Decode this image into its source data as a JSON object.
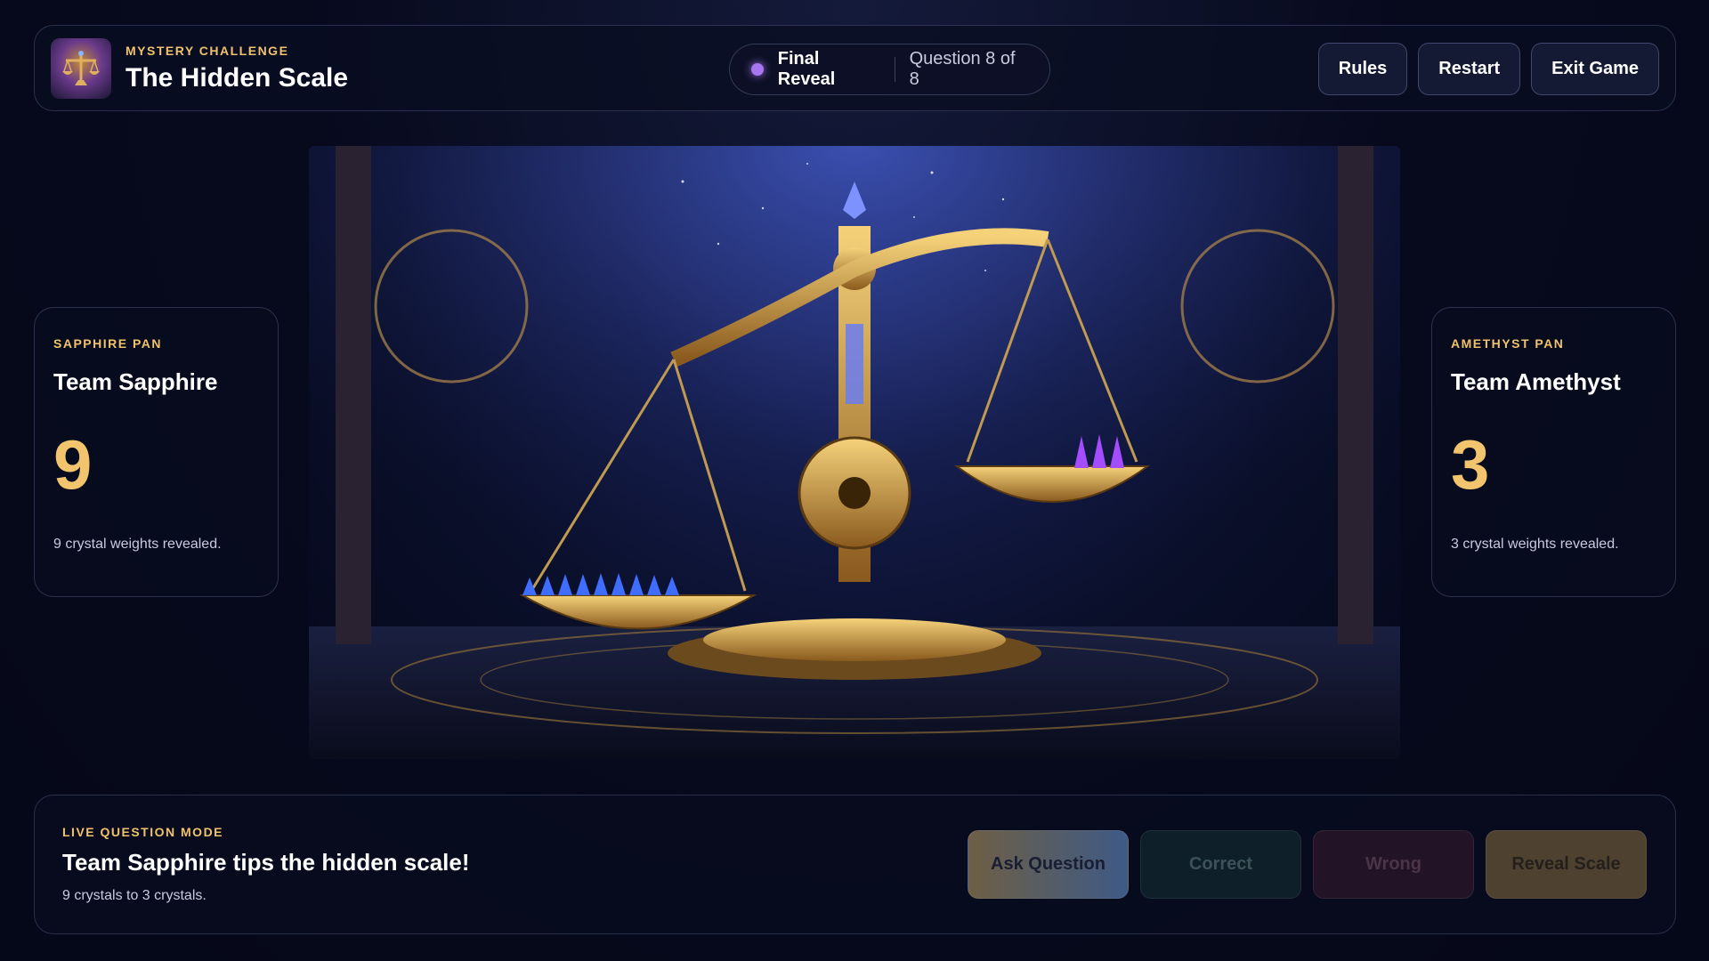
{
  "header": {
    "eyebrow": "MYSTERY CHALLENGE",
    "title": "The Hidden Scale",
    "status_phase": "Final Reveal",
    "status_question": "Question 8 of 8",
    "buttons": {
      "rules": "Rules",
      "restart": "Restart",
      "exit": "Exit Game"
    }
  },
  "teams": [
    {
      "eyebrow": "SAPPHIRE PAN",
      "name": "Team Sapphire",
      "score": "9",
      "note": "9 crystal weights revealed.",
      "color": "#4a6cff"
    },
    {
      "eyebrow": "AMETHYST PAN",
      "name": "Team Amethyst",
      "score": "3",
      "note": "3 crystal weights revealed.",
      "color": "#a44dff"
    }
  ],
  "scene": {
    "subject": "golden balance scale in observatory hall",
    "left_pan_crystals": 9,
    "right_pan_crystals": 3
  },
  "panel": {
    "eyebrow": "LIVE QUESTION MODE",
    "headline": "Team Sapphire tips the hidden scale!",
    "subline": "9 crystals to 3 crystals.",
    "buttons": {
      "ask": "Ask Question",
      "correct": "Correct",
      "wrong": "Wrong",
      "reveal": "Reveal Scale"
    }
  },
  "colors": {
    "accent_gold": "#f0c26b",
    "score_gold": "#f2c46e",
    "status_dot": "#a877f0",
    "background": "#070a1d"
  }
}
